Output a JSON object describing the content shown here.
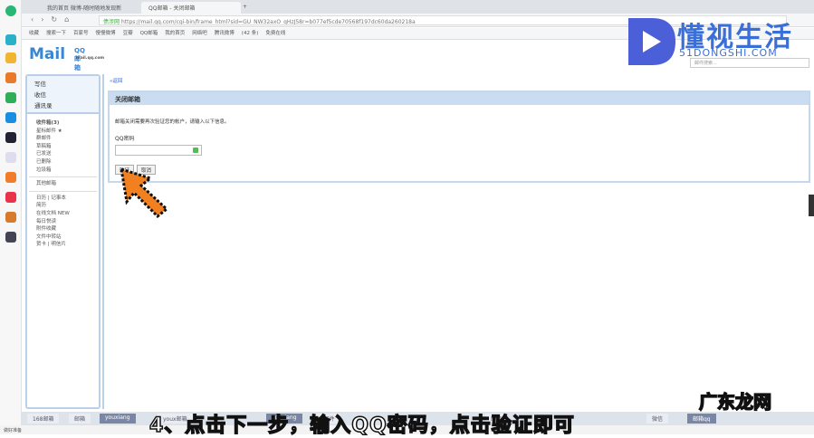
{
  "browser": {
    "tabs": [
      "我的首页 微博-随时随地发现新",
      "QQ邮箱 - 关闭邮箱"
    ],
    "url": "https://mail.qq.com/cgi-bin/frame_html?sid=GU_NW32axO_qHzJ58r=b077ef5cde70568f197dc60da260218a",
    "security": "债涉网",
    "bookmarks": [
      "收藏",
      "搜索一下",
      "百家号",
      "慢慢微博",
      "豆瓣",
      "QQ邮箱",
      "我的首页",
      "网络吧",
      "腾讯微博",
      "(42 条)",
      "免费在线"
    ]
  },
  "mail": {
    "logo": "Mail",
    "logo_cn": "QQ邮箱",
    "logo_domain": "mail.qq.com",
    "search_placeholder": "邮件搜索...",
    "sidebar_top": [
      "写信",
      "收信",
      "通讯录"
    ],
    "folders": [
      "收件箱(3)",
      "星标邮件 ★",
      "群邮件",
      "草稿箱",
      "已发送",
      "已删除",
      "垃圾箱"
    ],
    "other": "其他邮箱",
    "tools": [
      "日历 | 记事本",
      "简历",
      "在线文档 NEW",
      "每日悦读",
      "附件收藏",
      "文件中转站",
      "贺卡 | 明信片"
    ],
    "back": "«返回",
    "panel_title": "关闭邮箱",
    "message": "邮箱关闭需要再次验证您的帐户，请输入以下信息。",
    "password_label": "QQ密码",
    "verify": "验证",
    "cancel": "取消"
  },
  "taskbar": [
    "168邮箱",
    "邮箱",
    "youxiang",
    "youx邮箱",
    "youxiang",
    "qq邮件",
    "邮箱",
    "微信",
    "邮箱qq"
  ],
  "status": "做好准备",
  "subtitle": "4、点击下一步，输入QQ密码，点击验证即可",
  "watermarks": {
    "brand": "懂视生活",
    "brand_url": "51DONGSHI.COM",
    "corner": "广东龙网"
  }
}
